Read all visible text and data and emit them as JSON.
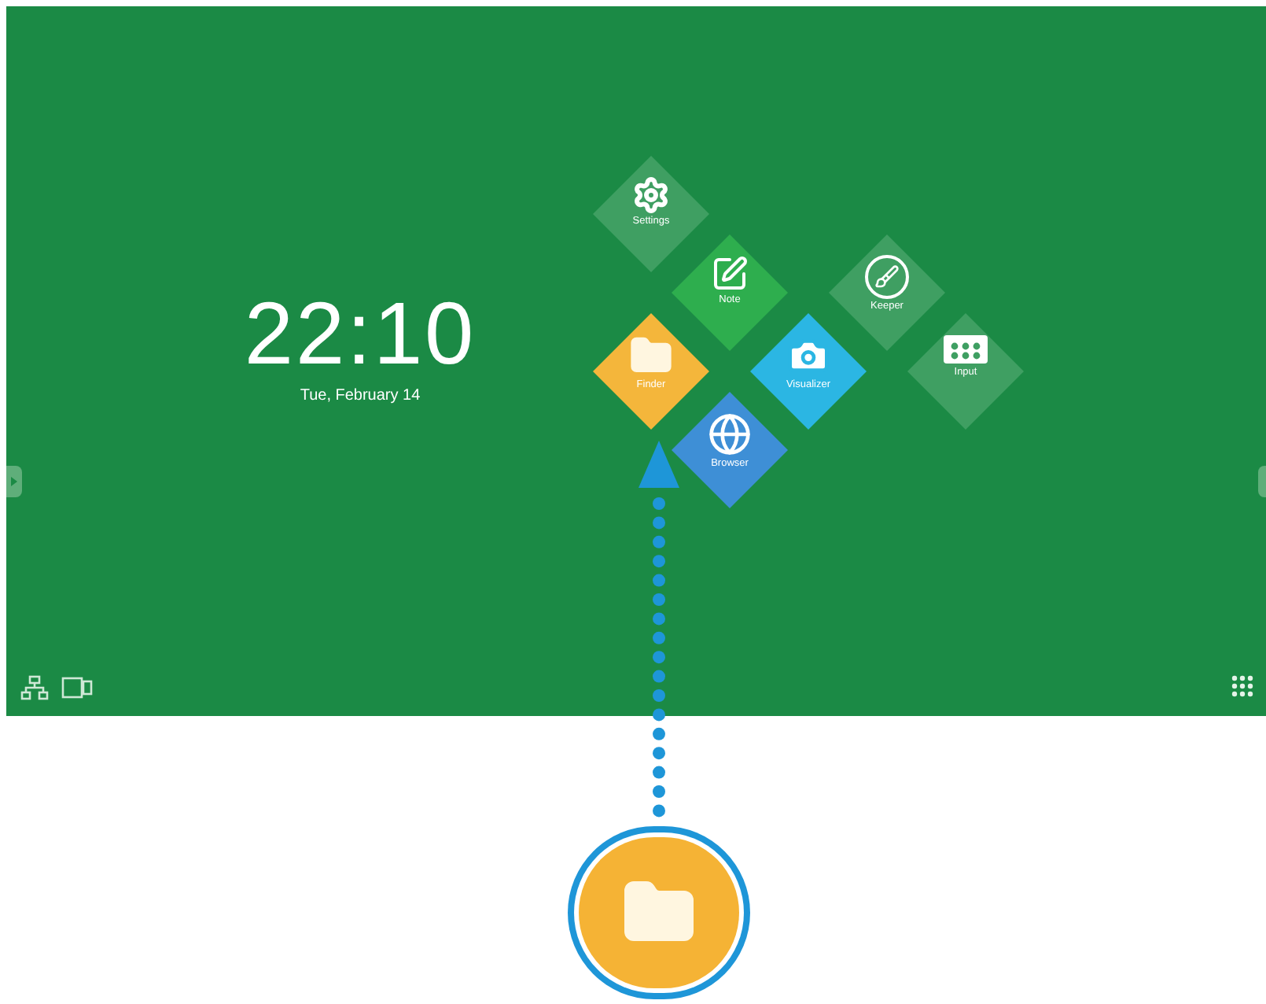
{
  "clock": {
    "time": "22:10",
    "date": "Tue, February 14"
  },
  "apps": [
    {
      "label": "Settings",
      "kind": "settings",
      "color": "#3f9f62"
    },
    {
      "label": "Note",
      "kind": "note",
      "color": "#2eae4e"
    },
    {
      "label": "Keeper",
      "kind": "keeper",
      "color": "#3f9f62"
    },
    {
      "label": "Finder",
      "kind": "finder",
      "color": "#f4b63b"
    },
    {
      "label": "Visualizer",
      "kind": "visualizer",
      "color": "#2bb6e3"
    },
    {
      "label": "Input",
      "kind": "input",
      "color": "#3f9f62"
    },
    {
      "label": "Browser",
      "kind": "browser",
      "color": "#3e8fd6"
    }
  ]
}
